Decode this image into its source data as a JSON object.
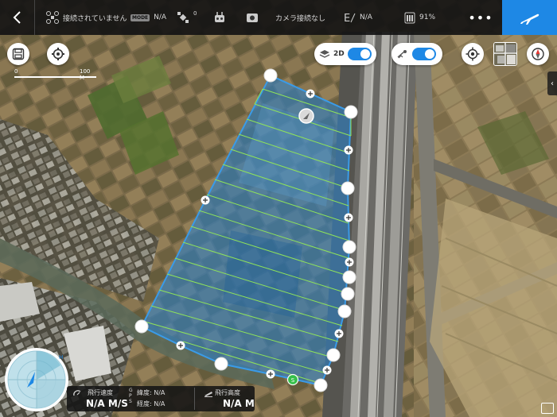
{
  "topbar": {
    "connection_status": "接続されていません",
    "mode_badge": "MODE",
    "mode_value": "N/A",
    "gps_count": "0",
    "camera_status": "カメラ接続なし",
    "exposure_value": "N/A",
    "battery_value": "91%",
    "more_label": "•••"
  },
  "map_controls": {
    "view_2d_label": "2D"
  },
  "scale": {
    "zero": "0",
    "max": "100 M"
  },
  "sidebar_tab": {
    "label": "‹"
  },
  "telemetry": {
    "h_speed_label": "飛行速度",
    "h_speed_value": "N/A M/S",
    "lat_label": "緯度: N/A",
    "lng_label": "経度: N/A",
    "gps_letters": "G\nP\nS",
    "altitude_label": "飛行高度",
    "altitude_value": "N/A M"
  },
  "colors": {
    "accent": "#1e88e5",
    "survey_fill": "#2f7fc4",
    "flight_line": "#8fe35a",
    "home_point": "#35c04a"
  },
  "icons": [
    "back-icon",
    "drone-icon",
    "mode-badge",
    "satellite-icon",
    "controller-icon",
    "camera-icon",
    "exposure-icon",
    "battery-icon",
    "more-icon",
    "takeoff-icon",
    "save-icon",
    "settings-icon",
    "layers-icon",
    "3d-icon",
    "locate-icon",
    "map-thumbnail-icon",
    "compass-icon",
    "home-point-icon",
    "aircraft-marker-icon"
  ]
}
